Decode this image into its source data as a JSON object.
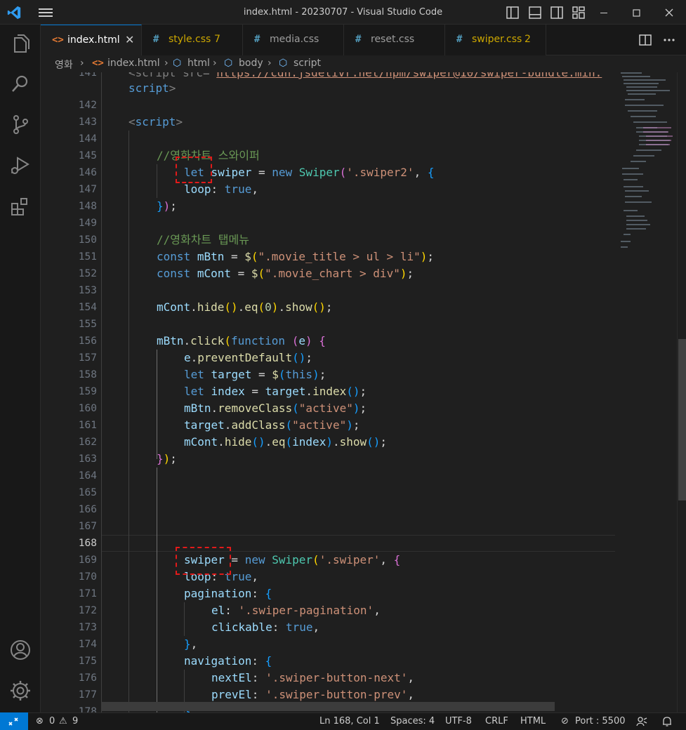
{
  "window": {
    "title": "index.html - 20230707 - Visual Studio Code"
  },
  "tabs": [
    {
      "icon": "<>",
      "label": "index.html",
      "badge": "",
      "color": "#ffffff",
      "active": true
    },
    {
      "icon": "#",
      "label": "style.css",
      "badge": "7",
      "color": "#cca700",
      "active": false
    },
    {
      "icon": "#",
      "label": "media.css",
      "badge": "",
      "color": "#9d9d9d",
      "active": false
    },
    {
      "icon": "#",
      "label": "reset.css",
      "badge": "",
      "color": "#9d9d9d",
      "active": false
    },
    {
      "icon": "#",
      "label": "swiper.css",
      "badge": "2",
      "color": "#cca700",
      "active": false
    }
  ],
  "breadcrumb": {
    "folder": "영화",
    "file": "index.html",
    "html": "html",
    "body": "body",
    "script": "script"
  },
  "line_numbers": [
    "141",
    "",
    "142",
    "143",
    "144",
    "145",
    "146",
    "147",
    "148",
    "149",
    "150",
    "151",
    "152",
    "153",
    "154",
    "155",
    "156",
    "157",
    "158",
    "159",
    "160",
    "161",
    "162",
    "163",
    "164",
    "165",
    "166",
    "167",
    "168",
    "169",
    "170",
    "171",
    "172",
    "173",
    "174",
    "175",
    "176",
    "177",
    "178"
  ],
  "code": {
    "l141_pre": "<script src=\"",
    "l141_url": "https://cdn.jsdelivr.net/npm/swiper@10/swiper-bundle.min.",
    "l141b": "script",
    "l143": "script",
    "l145": "//영화차트 스와이퍼",
    "l150": "//영화차트 탭메뉴",
    "s151": "\".movie_title > ul > li\"",
    "s152": "\".movie_chart > div\"",
    "s146": "'.swiper2'",
    "s169": "'.swiper'",
    "s172": "'.swiper-pagination'",
    "s176": "'.swiper-button-next'",
    "s177": "'.swiper-button-prev'",
    "active": "\"active\""
  },
  "status": {
    "errors": "0",
    "warnings": "9",
    "position": "Ln 168, Col 1",
    "spaces": "Spaces: 4",
    "encoding": "UTF-8",
    "eol": "CRLF",
    "language": "HTML",
    "port": "Port : 5500"
  },
  "colors": {
    "accent": "#0078d4",
    "annotation": "#e11a1a"
  }
}
